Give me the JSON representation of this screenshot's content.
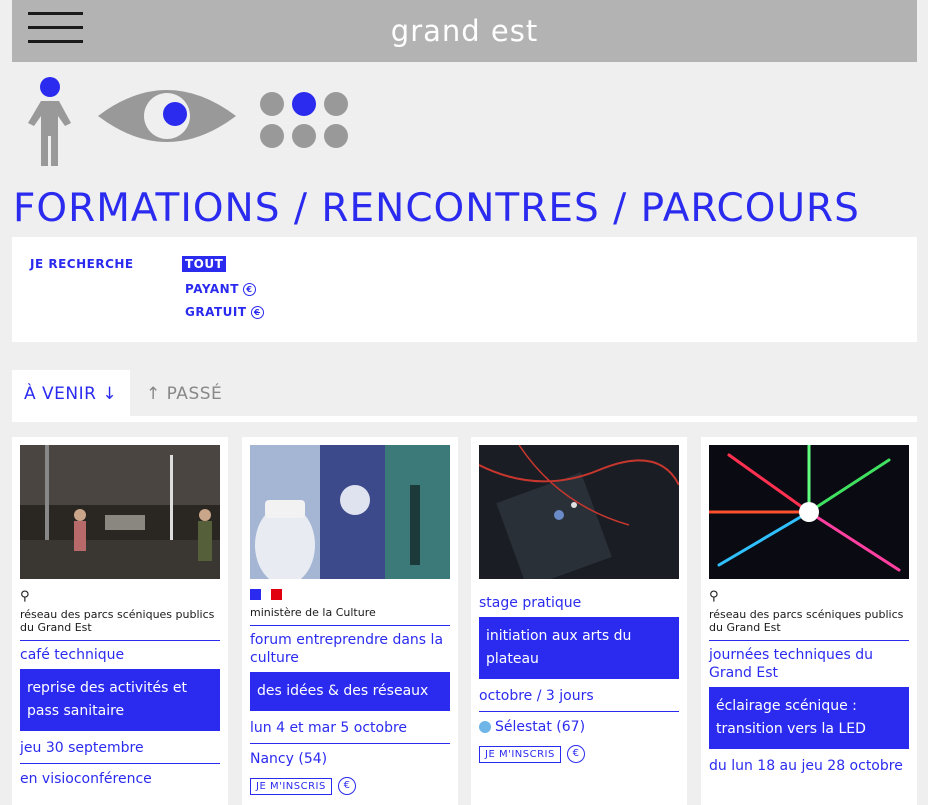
{
  "header": {
    "logo": "grand est"
  },
  "page_title": "FORMATIONS / RENCONTRES / PARCOURS",
  "filter": {
    "label": "JE RECHERCHE",
    "options": [
      {
        "label": "TOUT",
        "icon": ""
      },
      {
        "label": "PAYANT",
        "icon": "€"
      },
      {
        "label": "GRATUIT",
        "icon": "€"
      }
    ]
  },
  "tabs": {
    "upcoming": "À VENIR ↓",
    "past": "↑ PASSÉ"
  },
  "cards": [
    {
      "org": "réseau des parcs scéniques publics du Grand Est",
      "category": "café technique",
      "headline": "reprise des activités et pass sanitaire",
      "date": "jeu 30 septembre",
      "place": "en visioconférence"
    },
    {
      "org": "ministère de la Culture",
      "category": "forum entreprendre dans la culture",
      "headline": "des idées & des réseaux",
      "date": "lun 4 et mar 5 octobre",
      "place": "Nancy (54)",
      "register": "JE M'INSCRIS",
      "price_icon": "€"
    },
    {
      "category": "stage pratique",
      "headline": "initiation aux arts du plateau",
      "date": "octobre / 3 jours",
      "place": "Sélestat (67)",
      "register": "JE M'INSCRIS",
      "price_icon": "€"
    },
    {
      "org": "réseau des parcs scéniques publics du Grand Est",
      "category": "journées techniques du Grand Est",
      "headline": "éclairage scénique : transition vers la LED",
      "date": "du lun 18 au jeu 28 octobre"
    }
  ],
  "colors": {
    "accent": "#2b2bf0",
    "header": "#b3b3b3",
    "background": "#efefef"
  }
}
